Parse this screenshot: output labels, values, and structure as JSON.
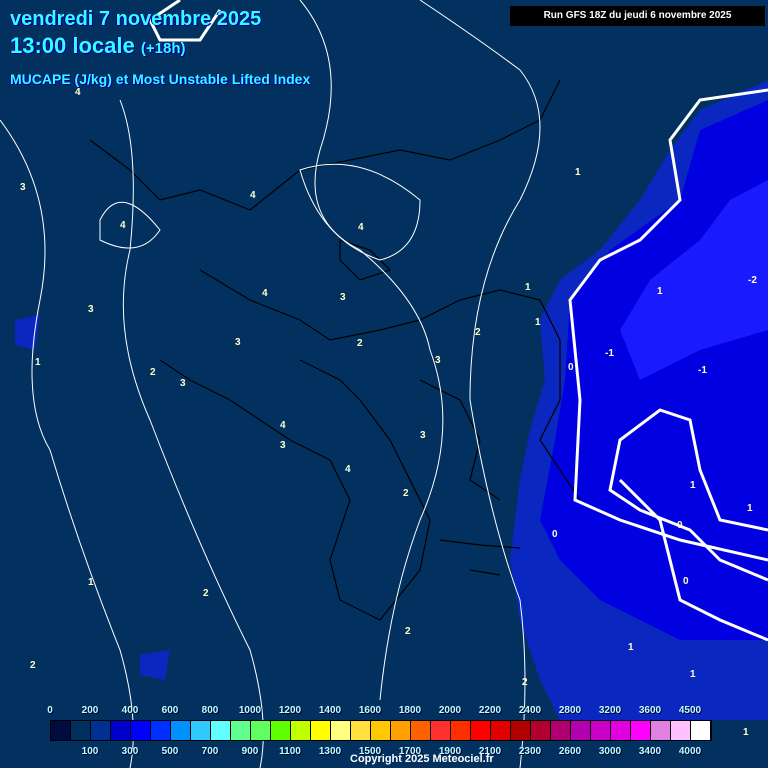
{
  "header": {
    "date": "vendredi 7 novembre 2025",
    "time": "13:00 locale",
    "offset": "(+18h)",
    "parameter": "MUCAPE (J/kg) et Most Unstable Lifted Index",
    "run": "Run GFS 18Z du jeudi 6 novembre 2025"
  },
  "map": {
    "contour_labels": [
      "4",
      "3",
      "4",
      "4",
      "4",
      "4",
      "3",
      "3",
      "3",
      "2",
      "3",
      "2",
      "2",
      "1",
      "4",
      "3",
      "4",
      "3",
      "3",
      "2",
      "1",
      "1",
      "1",
      "1",
      "0",
      "-1",
      "-1",
      "-2",
      "1",
      "1",
      "0",
      "0",
      "0",
      "1",
      "2",
      "2",
      "2",
      "1",
      "1",
      "2",
      "1"
    ]
  },
  "colorbar": {
    "colors": [
      "#000c40",
      "#00305e",
      "#003090",
      "#0000c8",
      "#0000ff",
      "#0030ff",
      "#0090ff",
      "#30c8ff",
      "#60ffff",
      "#60ff90",
      "#60ff60",
      "#60ff00",
      "#c0ff00",
      "#ffff00",
      "#ffff80",
      "#ffe040",
      "#ffc800",
      "#ffa000",
      "#ff6000",
      "#ff3030",
      "#ff3000",
      "#ff0000",
      "#e00000",
      "#b00000",
      "#b00030",
      "#b00070",
      "#b000b0",
      "#c800c8",
      "#e000e0",
      "#ff00ff",
      "#e080e0",
      "#ffc0ff",
      "#ffffff"
    ],
    "top_labels": [
      "0",
      "200",
      "400",
      "600",
      "800",
      "1000",
      "1200",
      "1400",
      "1600",
      "1800",
      "2000",
      "2200",
      "2400",
      "2800",
      "3200",
      "3600",
      "4500"
    ],
    "bottom_labels": [
      "100",
      "300",
      "500",
      "700",
      "900",
      "1100",
      "1300",
      "1500",
      "1700",
      "1900",
      "2100",
      "2300",
      "2600",
      "3000",
      "3400",
      "4000"
    ]
  },
  "footer": {
    "copyright": "Copyright 2025 Meteociel.fr"
  }
}
